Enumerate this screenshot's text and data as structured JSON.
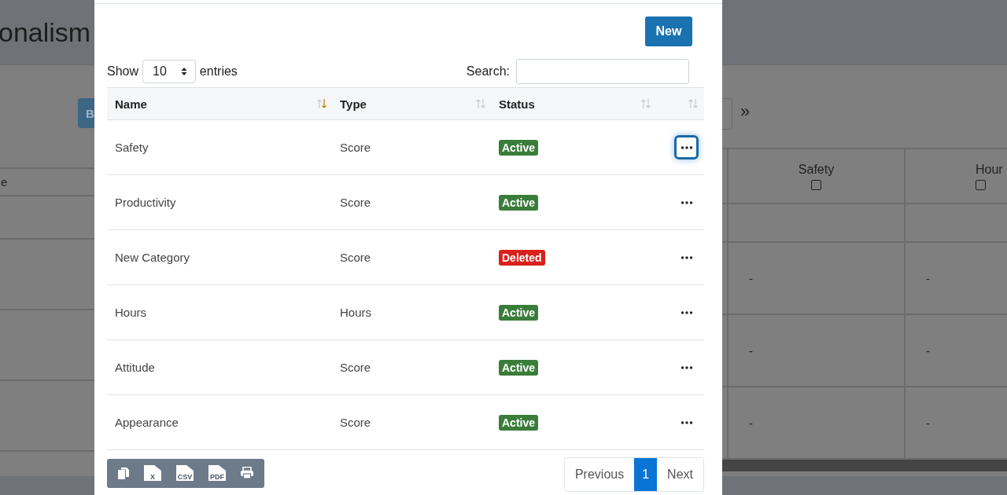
{
  "background_page": {
    "title": "onalism",
    "button": "B",
    "left_header": "e",
    "pager_next": "»",
    "columns": [
      {
        "label": "Safety",
        "checked": false
      },
      {
        "label": "Hour",
        "checked": false
      }
    ],
    "rows": [
      [
        "-",
        "-"
      ],
      [
        "-",
        "-"
      ],
      [
        "-",
        "-"
      ]
    ]
  },
  "modal": {
    "new_button": "New",
    "length": {
      "before": "Show",
      "value": "10",
      "after": "entries"
    },
    "search": {
      "label": "Search:"
    },
    "columns": [
      {
        "label": "Name",
        "sorted": true
      },
      {
        "label": "Type",
        "sorted": false
      },
      {
        "label": "Status",
        "sorted": false
      },
      {
        "sorted": false
      }
    ],
    "rows": [
      {
        "name": "Safety",
        "type": "Score",
        "status": {
          "label": "Active",
          "kind": "active"
        },
        "focused": true
      },
      {
        "name": "Productivity",
        "type": "Score",
        "status": {
          "label": "Active",
          "kind": "active"
        },
        "focused": false
      },
      {
        "name": "New Category",
        "type": "Score",
        "status": {
          "label": "Deleted",
          "kind": "deleted"
        },
        "focused": false
      },
      {
        "name": "Hours",
        "type": "Hours",
        "status": {
          "label": "Active",
          "kind": "active"
        },
        "focused": false
      },
      {
        "name": "Attitude",
        "type": "Score",
        "status": {
          "label": "Active",
          "kind": "active"
        },
        "focused": false
      },
      {
        "name": "Appearance",
        "type": "Score",
        "status": {
          "label": "Active",
          "kind": "active"
        },
        "focused": false
      }
    ],
    "export_buttons": [
      {
        "kind": "copy"
      },
      {
        "kind": "excel",
        "label": "X"
      },
      {
        "kind": "csv",
        "label": "CSV"
      },
      {
        "kind": "pdf",
        "label": "PDF"
      },
      {
        "kind": "print"
      }
    ],
    "pagination": [
      {
        "label": "Previous",
        "selected": false
      },
      {
        "label": "1",
        "selected": true
      },
      {
        "label": "Next",
        "selected": false
      }
    ]
  }
}
